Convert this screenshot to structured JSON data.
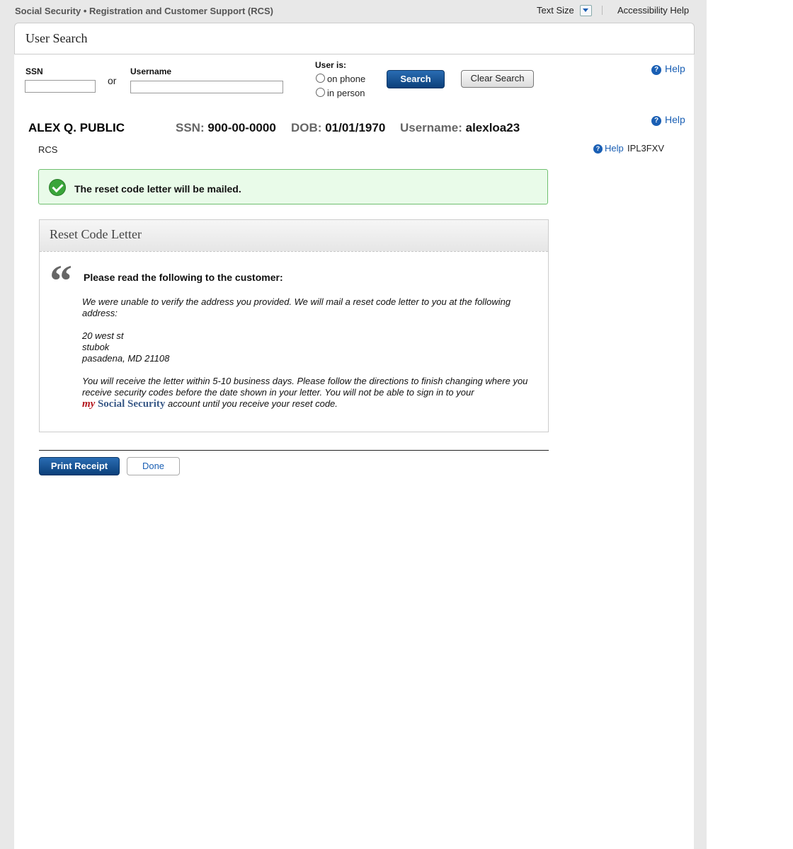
{
  "header": {
    "app_title": "Social Security • Registration and Customer Support (RCS)",
    "text_size_label": "Text Size",
    "accessibility_help": "Accessibility Help"
  },
  "search": {
    "title": "User Search",
    "ssn_label": "SSN",
    "ssn_value": "",
    "or_label": "or",
    "username_label": "Username",
    "username_value": "",
    "user_is_label": "User is:",
    "options": [
      "on phone",
      "in person"
    ],
    "search_button": "Search",
    "clear_button": "Clear Search",
    "help_label": "Help"
  },
  "customer": {
    "name": "ALEX Q. PUBLIC",
    "ssn_label": "SSN:",
    "ssn_value": "900-00-0000",
    "dob_label": "DOB:",
    "dob_value": "01/01/1970",
    "username_label": "Username:",
    "username_value": "alexloa23",
    "help_label": "Help",
    "section_label": "RCS",
    "small_help_label": "Help",
    "code_id": "IPL3FXV"
  },
  "success": {
    "message": "The reset code letter will be mailed."
  },
  "letter": {
    "title": "Reset Code Letter",
    "read_label": "Please read the following to the customer:",
    "para1": "We were unable to verify the address you provided. We will mail a reset code letter to you at the following address:",
    "address": [
      "20 west st",
      "stubok",
      "pasadena, MD 21108"
    ],
    "para2": "You will receive the letter within 5-10 business days. Please follow the directions to finish changing where you receive security codes before the date shown in your letter. You will not be able to sign in to your",
    "brand_my": "my",
    "brand_ss": "Social Security",
    "para2_end": "account until you receive your reset code."
  },
  "actions": {
    "print_receipt": "Print Receipt",
    "done": "Done"
  },
  "colors": {
    "primary_blue": "#0b3f7a",
    "link_blue": "#1a5fb4",
    "success_green": "#3aa53a",
    "brand_red": "#b3141b"
  }
}
